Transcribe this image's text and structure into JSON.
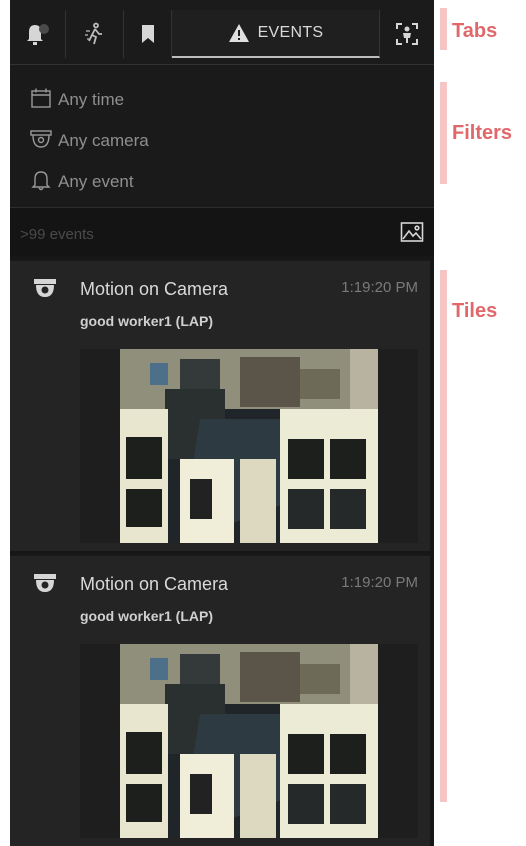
{
  "tabs": {
    "events_label": "EVENTS",
    "items": [
      {
        "name": "notifications",
        "icon": "bell-icon"
      },
      {
        "name": "motion",
        "icon": "walking-person-icon"
      },
      {
        "name": "bookmarks",
        "icon": "bookmark-icon"
      },
      {
        "name": "events",
        "icon": "warning-triangle-icon"
      },
      {
        "name": "face-detection",
        "icon": "person-frame-icon"
      }
    ]
  },
  "filters": [
    {
      "label": "Any time",
      "icon": "calendar-icon"
    },
    {
      "label": "Any camera",
      "icon": "dome-camera-icon"
    },
    {
      "label": "Any event",
      "icon": "bell-outline-icon"
    }
  ],
  "count_bar": {
    "label": ">99 events",
    "thumbnail_toggle_icon": "image-icon"
  },
  "tiles": [
    {
      "title": "Motion on Camera",
      "time": "1:19:20 PM",
      "subtitle": "good worker1 (LAP)",
      "icon": "camera-icon"
    },
    {
      "title": "Motion on Camera",
      "time": "1:19:20 PM",
      "subtitle": "good worker1 (LAP)",
      "icon": "camera-icon"
    }
  ],
  "annotations": {
    "tabs": "Tabs",
    "filters": "Filters",
    "tiles": "Tiles"
  },
  "colors": {
    "panel_bg": "#171717",
    "tile_bg": "#242424",
    "annotation": "#e0676a",
    "annotation_bar": "#f6c6c6"
  }
}
